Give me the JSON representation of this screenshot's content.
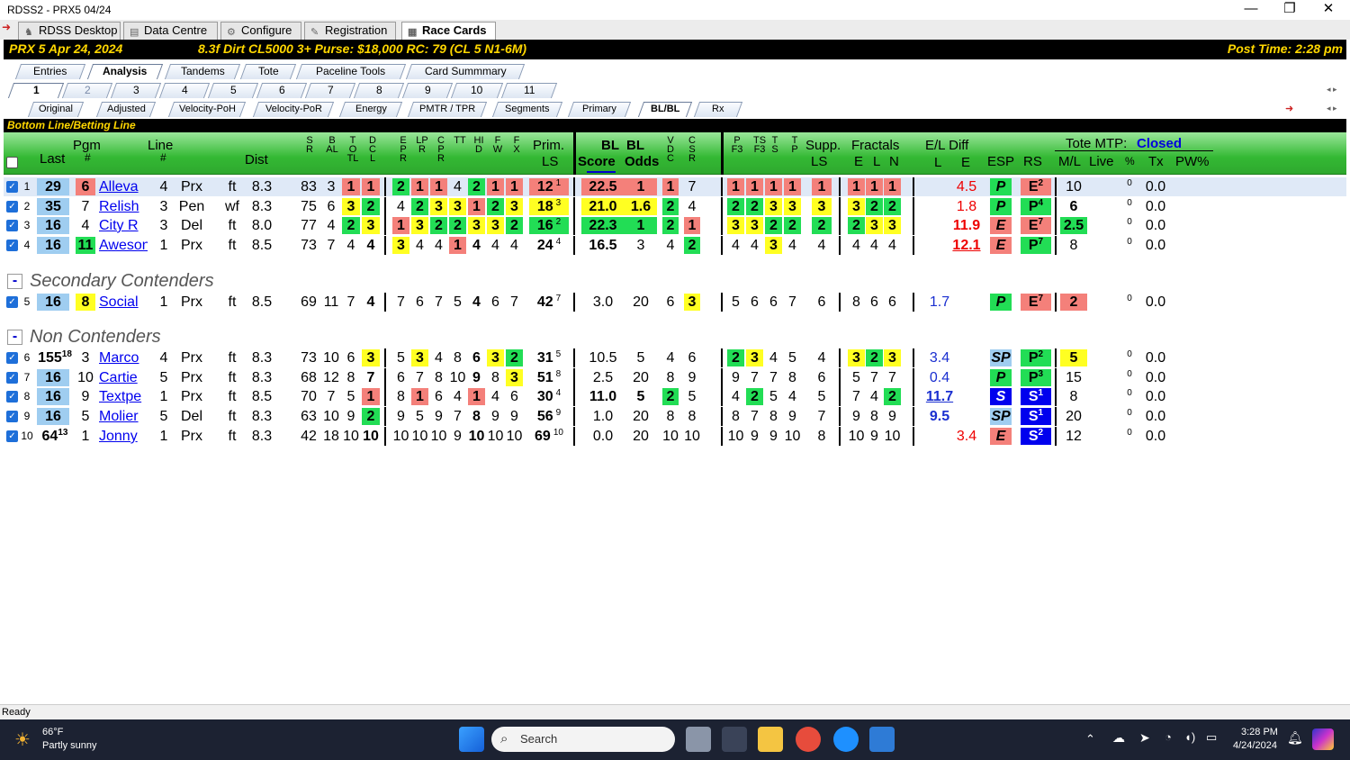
{
  "window": {
    "title": "RDSS2 - PRX5  04/24",
    "min": "—",
    "max": "❐",
    "close": "✕"
  },
  "app_tabs": [
    {
      "label": "RDSS Desktop"
    },
    {
      "label": "Data Centre"
    },
    {
      "label": "Configure"
    },
    {
      "label": "Registration"
    },
    {
      "label": "Race Cards"
    }
  ],
  "race_header": {
    "left": "PRX  5  Apr 24, 2024",
    "info": "8.3f  Dirt   CL5000  3+   Purse: $18,000   RC: 79  (CL 5 N1-6M)",
    "post": "Post Time: 2:28 pm"
  },
  "view_tabs": [
    "Entries",
    "Analysis",
    "Tandems",
    "Tote",
    "Paceline Tools",
    "Card Summmary"
  ],
  "race_tabs": [
    "1",
    "2",
    "3",
    "4",
    "5",
    "6",
    "7",
    "8",
    "9",
    "10",
    "11"
  ],
  "analysis_tabs": [
    "Original",
    "Adjusted",
    "Velocity-PoH",
    "Velocity-PoR",
    "Energy",
    "PMTR / TPR",
    "Segments",
    "Primary",
    "BL/BL",
    "Rx"
  ],
  "section_title": "Bottom Line/Betting Line",
  "headers": {
    "last": "Last",
    "pgm": "Pgm",
    "pgm_hash": "#",
    "line": "Line",
    "line_hash": "#",
    "dist": "Dist",
    "sr": "SR",
    "bal": "BAL",
    "totl": "TOTL",
    "dcl": "DCL",
    "epr": "EPR",
    "lpr": "LPR",
    "cpr": "CPR",
    "tt": "TT",
    "hid": "HID",
    "fw": "FW",
    "fx": "FX",
    "prim": "Prim.",
    "prim_ls": "LS",
    "bl_score": "BL",
    "bl_score2": "Score",
    "bl_odds": "BL",
    "bl_odds2": "Odds",
    "vdc": "VDC",
    "csr": "CSR",
    "pf3": "PF3",
    "tsf3": "TSF3",
    "ts": "TS",
    "tp": "TP",
    "supp": "Supp.",
    "supp_ls": "LS",
    "fractals": "Fractals",
    "fr_e": "E",
    "fr_l": "L",
    "fr_n": "N",
    "el_diff": "E/L Diff",
    "el_l": "L",
    "el_e": "E",
    "esp": "ESP",
    "rs": "RS",
    "tote_mtp": "Tote MTP:",
    "tote_status": "Closed",
    "ml": "M/L",
    "live": "Live",
    "pct": "%",
    "tx": "Tx",
    "pw": "PW%"
  },
  "groups": [
    {
      "label": "Secondary Contenders",
      "toggle": "-"
    },
    {
      "label": "Non Contenders",
      "toggle": "-"
    }
  ],
  "rows": [
    {
      "n": "1",
      "last": "29",
      "lastsup": "",
      "pgm": "6",
      "name": "Alleva",
      "line": "4",
      "trk": "Prx",
      "sf": "ft",
      "dist": "8.3",
      "sr": "83",
      "bal": "3",
      "totl": "1",
      "dcl": "1",
      "ep": [
        "2",
        "1",
        "1",
        "4",
        "2",
        "1",
        "1"
      ],
      "prim": "12",
      "primsup": "1",
      "score": "22.5",
      "odds": "1",
      "vdc": "1",
      "csr": "7",
      "pf": [
        "1",
        "1",
        "1",
        "1"
      ],
      "supp": "1",
      "fr": [
        "1",
        "1",
        "1"
      ],
      "eld": "4.5",
      "esp": "P",
      "rs": "E",
      "rssup": "2",
      "ml": "10",
      "live": "0",
      "tx": "0.0"
    },
    {
      "n": "2",
      "last": "35",
      "lastsup": "",
      "pgm": "7",
      "name": "Relish",
      "line": "3",
      "trk": "Pen",
      "sf": "wf",
      "dist": "8.3",
      "sr": "75",
      "bal": "6",
      "totl": "3",
      "dcl": "2",
      "ep": [
        "4",
        "2",
        "3",
        "3",
        "1",
        "2",
        "3"
      ],
      "prim": "18",
      "primsup": "3",
      "score": "21.0",
      "odds": "1.6",
      "vdc": "2",
      "csr": "4",
      "pf": [
        "2",
        "2",
        "3",
        "3"
      ],
      "supp": "3",
      "fr": [
        "3",
        "2",
        "2"
      ],
      "eld": "1.8",
      "esp": "P",
      "rs": "P",
      "rssup": "4",
      "ml": "6",
      "live": "0",
      "tx": "0.0"
    },
    {
      "n": "3",
      "last": "16",
      "lastsup": "",
      "pgm": "4",
      "name": "City R",
      "line": "3",
      "trk": "Del",
      "sf": "ft",
      "dist": "8.0",
      "sr": "77",
      "bal": "4",
      "totl": "2",
      "dcl": "3",
      "ep": [
        "1",
        "3",
        "2",
        "2",
        "3",
        "3",
        "2"
      ],
      "prim": "16",
      "primsup": "2",
      "score": "22.3",
      "odds": "1",
      "vdc": "2",
      "csr": "1",
      "pf": [
        "3",
        "3",
        "2",
        "2"
      ],
      "supp": "2",
      "fr": [
        "2",
        "3",
        "3"
      ],
      "eld": "11.9",
      "esp": "E",
      "rs": "E",
      "rssup": "7",
      "ml": "2.5",
      "live": "0",
      "tx": "0.0"
    },
    {
      "n": "4",
      "last": "16",
      "lastsup": "",
      "pgm": "11",
      "name": "Aweson",
      "line": "1",
      "trk": "Prx",
      "sf": "ft",
      "dist": "8.5",
      "sr": "73",
      "bal": "7",
      "totl": "4",
      "dcl": "4",
      "ep": [
        "3",
        "4",
        "4",
        "1",
        "4",
        "4",
        "4"
      ],
      "prim": "24",
      "primsup": "4",
      "score": "16.5",
      "odds": "3",
      "vdc": "4",
      "csr": "2",
      "pf": [
        "4",
        "4",
        "3",
        "4"
      ],
      "supp": "4",
      "fr": [
        "4",
        "4",
        "4"
      ],
      "eld": "12.1",
      "esp": "E",
      "rs": "P",
      "rssup": "7",
      "ml": "8",
      "live": "0",
      "tx": "0.0"
    },
    {
      "n": "5",
      "last": "16",
      "lastsup": "",
      "pgm": "8",
      "name": "Social",
      "line": "1",
      "trk": "Prx",
      "sf": "ft",
      "dist": "8.5",
      "sr": "69",
      "bal": "11",
      "totl": "7",
      "dcl": "4",
      "ep": [
        "7",
        "6",
        "7",
        "5",
        "4",
        "6",
        "7"
      ],
      "prim": "42",
      "primsup": "7",
      "score": "3.0",
      "odds": "20",
      "vdc": "6",
      "csr": "3",
      "pf": [
        "5",
        "6",
        "6",
        "7"
      ],
      "supp": "6",
      "fr": [
        "8",
        "6",
        "6"
      ],
      "eld": "1.7",
      "esp": "P",
      "rs": "E",
      "rssup": "7",
      "ml": "2",
      "live": "0",
      "tx": "0.0"
    },
    {
      "n": "6",
      "last": "155",
      "lastsup": "18",
      "pgm": "3",
      "name": "Marco",
      "line": "4",
      "trk": "Prx",
      "sf": "ft",
      "dist": "8.3",
      "sr": "73",
      "bal": "10",
      "totl": "6",
      "dcl": "3",
      "ep": [
        "5",
        "3",
        "4",
        "8",
        "6",
        "3",
        "2"
      ],
      "prim": "31",
      "primsup": "5",
      "score": "10.5",
      "odds": "5",
      "vdc": "4",
      "csr": "6",
      "pf": [
        "2",
        "3",
        "4",
        "5"
      ],
      "supp": "4",
      "fr": [
        "3",
        "2",
        "3"
      ],
      "eld": "3.4",
      "esp": "SP",
      "rs": "P",
      "rssup": "2",
      "ml": "5",
      "live": "0",
      "tx": "0.0"
    },
    {
      "n": "7",
      "last": "16",
      "lastsup": "",
      "pgm": "10",
      "name": "Cartie",
      "line": "5",
      "trk": "Prx",
      "sf": "ft",
      "dist": "8.3",
      "sr": "68",
      "bal": "12",
      "totl": "8",
      "dcl": "7",
      "ep": [
        "6",
        "7",
        "8",
        "10",
        "9",
        "8",
        "3"
      ],
      "prim": "51",
      "primsup": "8",
      "score": "2.5",
      "odds": "20",
      "vdc": "8",
      "csr": "9",
      "pf": [
        "9",
        "7",
        "7",
        "8"
      ],
      "supp": "6",
      "fr": [
        "5",
        "7",
        "7"
      ],
      "eld": "0.4",
      "esp": "P",
      "rs": "P",
      "rssup": "3",
      "ml": "15",
      "live": "0",
      "tx": "0.0"
    },
    {
      "n": "8",
      "last": "16",
      "lastsup": "",
      "pgm": "9",
      "name": "Textpe",
      "line": "1",
      "trk": "Prx",
      "sf": "ft",
      "dist": "8.5",
      "sr": "70",
      "bal": "7",
      "totl": "5",
      "dcl": "1",
      "ep": [
        "8",
        "1",
        "6",
        "4",
        "1",
        "4",
        "6"
      ],
      "prim": "30",
      "primsup": "4",
      "score": "11.0",
      "odds": "5",
      "vdc": "2",
      "csr": "5",
      "pf": [
        "4",
        "2",
        "5",
        "4"
      ],
      "supp": "5",
      "fr": [
        "7",
        "4",
        "2"
      ],
      "eld": "11.7",
      "esp": "S",
      "rs": "S",
      "rssup": "1",
      "ml": "8",
      "live": "0",
      "tx": "0.0"
    },
    {
      "n": "9",
      "last": "16",
      "lastsup": "",
      "pgm": "5",
      "name": "Molier",
      "line": "5",
      "trk": "Del",
      "sf": "ft",
      "dist": "8.3",
      "sr": "63",
      "bal": "10",
      "totl": "9",
      "dcl": "2",
      "ep": [
        "9",
        "5",
        "9",
        "7",
        "8",
        "9",
        "9"
      ],
      "prim": "56",
      "primsup": "9",
      "score": "1.0",
      "odds": "20",
      "vdc": "8",
      "csr": "8",
      "pf": [
        "8",
        "7",
        "8",
        "9"
      ],
      "supp": "7",
      "fr": [
        "9",
        "8",
        "9"
      ],
      "eld": "9.5",
      "esp": "SP",
      "rs": "S",
      "rssup": "1",
      "ml": "20",
      "live": "0",
      "tx": "0.0"
    },
    {
      "n": "10",
      "last": "64",
      "lastsup": "13",
      "pgm": "1",
      "name": "Jonny",
      "line": "1",
      "trk": "Prx",
      "sf": "ft",
      "dist": "8.3",
      "sr": "42",
      "bal": "18",
      "totl": "10",
      "dcl": "10",
      "ep": [
        "10",
        "10",
        "10",
        "9",
        "10",
        "10",
        "10"
      ],
      "prim": "69",
      "primsup": "10",
      "score": "0.0",
      "odds": "20",
      "vdc": "10",
      "csr": "10",
      "pf": [
        "10",
        "9",
        "9",
        "10"
      ],
      "supp": "8",
      "fr": [
        "10",
        "9",
        "10"
      ],
      "eld": "3.4",
      "esp": "E",
      "rs": "S",
      "rssup": "2",
      "ml": "12",
      "live": "0",
      "tx": "0.0"
    }
  ],
  "status": "Ready",
  "taskbar": {
    "temp": "66°F",
    "weather": "Partly sunny",
    "search": "Search",
    "time": "3:28 PM",
    "date": "4/24/2024"
  },
  "colors": {
    "red": "#f4807a",
    "green": "#22dd55",
    "yellow": "#ffff22",
    "lightblue": "#9fcdf0",
    "blue": "#0000ee"
  }
}
